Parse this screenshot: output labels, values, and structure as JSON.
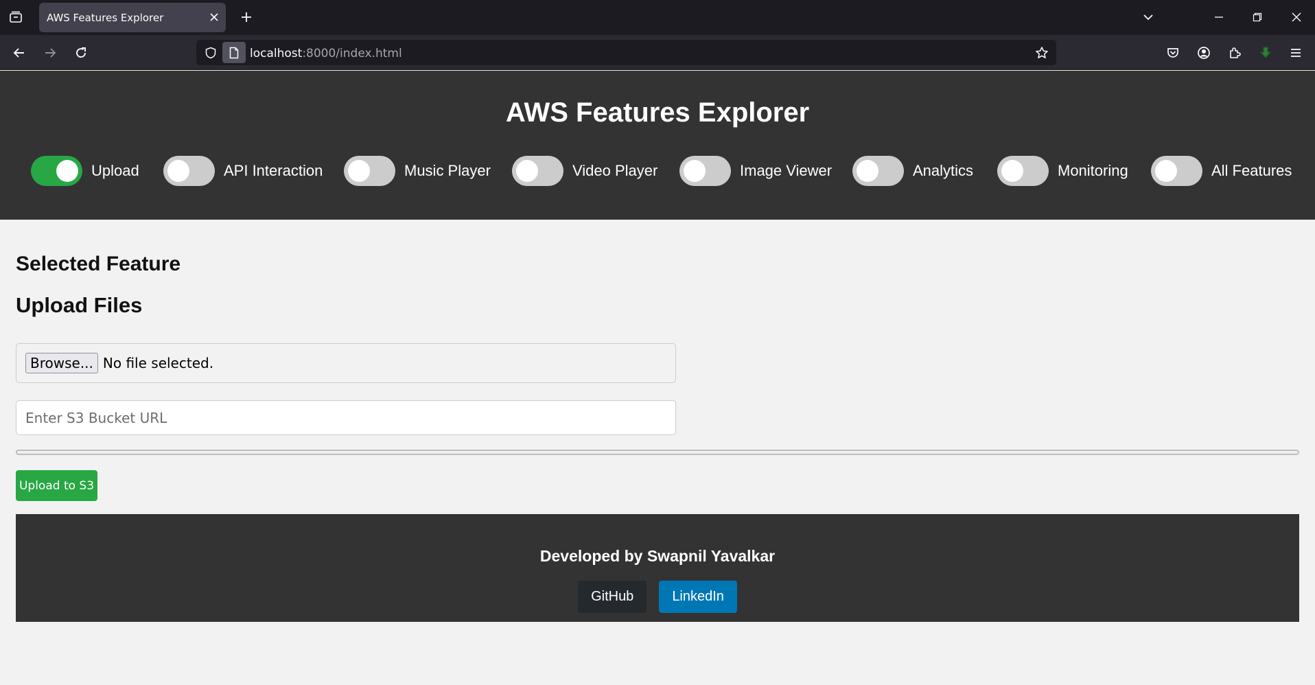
{
  "browser": {
    "tab_title": "AWS Features Explorer",
    "url_host": "localhost",
    "url_rest": ":8000/index.html",
    "icons": [
      "tab-list-icon",
      "close-icon",
      "new-tab-icon",
      "list-all-tabs-icon",
      "minimize-icon",
      "restore-icon",
      "window-close-icon",
      "back-icon",
      "forward-icon",
      "reload-icon",
      "shield-icon",
      "page-icon",
      "bookmark-star-icon",
      "pocket-icon",
      "account-icon",
      "extensions-icon",
      "download-icon",
      "menu-icon"
    ]
  },
  "header": {
    "title": "AWS Features Explorer",
    "toggles": [
      {
        "label": "Upload",
        "on": true
      },
      {
        "label": "API Interaction",
        "on": false
      },
      {
        "label": "Music Player",
        "on": false
      },
      {
        "label": "Video Player",
        "on": false
      },
      {
        "label": "Image Viewer",
        "on": false
      },
      {
        "label": "Analytics",
        "on": false
      },
      {
        "label": "Monitoring",
        "on": false
      },
      {
        "label": "All Features",
        "on": false
      }
    ]
  },
  "main": {
    "selected_heading": "Selected Feature",
    "upload_heading": "Upload Files",
    "browse_label": "Browse...",
    "file_status": "No file selected.",
    "bucket_placeholder": "Enter S3 Bucket URL",
    "bucket_value": "",
    "progress": 0,
    "upload_button": "Upload to S3"
  },
  "footer": {
    "text": "Developed by Swapnil Yavalkar",
    "links": [
      {
        "label": "GitHub",
        "color": "#24292e"
      },
      {
        "label": "LinkedIn",
        "color": "#0077b5"
      }
    ]
  },
  "colors": {
    "accent_green": "#28a745",
    "header_bg": "#333333",
    "page_bg": "#f2f2f2"
  }
}
